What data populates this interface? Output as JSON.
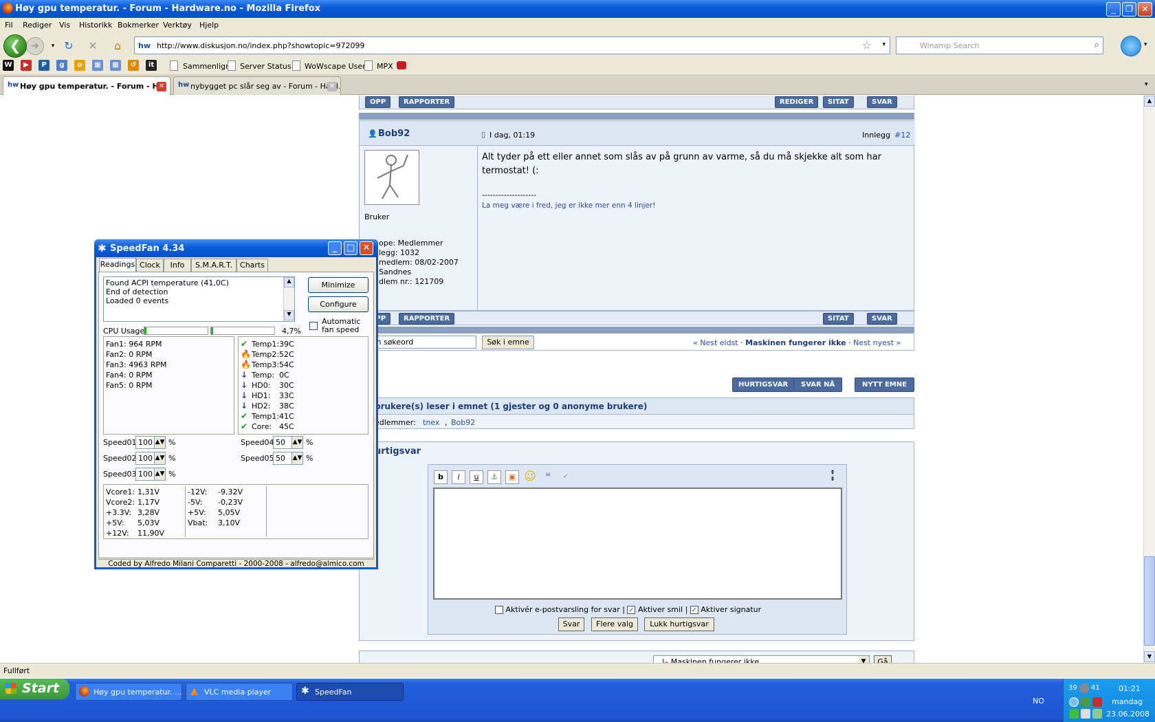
{
  "window": {
    "title": "Høy gpu temperatur. - Forum - Hardware.no - Mozilla Firefox"
  },
  "menu": [
    "Fil",
    "Rediger",
    "Vis",
    "Historikk",
    "Bokmerker",
    "Verktøy",
    "Hjelp"
  ],
  "nav": {
    "url": "http://www.diskusjon.no/index.php?showtopic=972099",
    "search_placeholder": "Winamp Search",
    "url_icon": "hw"
  },
  "bookmarks": [
    "Sammenlign",
    "Server Status",
    "WoWscape User",
    "MPX"
  ],
  "tabs": [
    {
      "label": "Høy gpu temperatur. - Forum - H...",
      "active": true
    },
    {
      "label": "nybygget pc slår seg av - Forum - Hard...",
      "active": false
    }
  ],
  "forum": {
    "top_buttons": {
      "opp": "OPP",
      "rapporter": "RAPPORTER",
      "rediger": "REDIGER",
      "sitat": "SITAT",
      "svar": "SVAR"
    },
    "post": {
      "author": "Bob92",
      "time": "I dag, 01:19",
      "post_label": "Innlegg",
      "post_num": "#12",
      "body_line1": "Alt tyder på ett eller annet som slås av på grunn av varme, så du må skjekke alt som har",
      "body_line2": "termostat! (:",
      "separator": "--------------------",
      "signature": "La meg være i fred, jeg er ikke mer enn 4 linjer!",
      "rank": "Bruker",
      "info": [
        "ope: Medlemmer",
        "legg: 1032",
        "medlem: 08/02-2007",
        "Sandnes",
        "dlem nr.: 121709"
      ]
    },
    "bottom_buttons": {
      "opp": "OPP",
      "rapporter": "RAPPORTER",
      "sitat": "SITAT",
      "svar": "SVAR"
    },
    "search": {
      "value": "g inn søkeord",
      "button": "Søk i emne"
    },
    "pager": {
      "prev": "« Nest eldst",
      "sep1": "·",
      "title": "Maskinen fungerer ikke",
      "sep2": "·",
      "next": "Nest nyest »"
    },
    "actions": [
      "HURTIGSVAR",
      "SVAR NÅ",
      "NYTT EMNE"
    ],
    "readers": {
      "title": "brukere(s) leser i emnet (1 gjester og 0 anonyme brukere)",
      "members_label": "edlemmer:",
      "members": [
        "tnex",
        "Bob92"
      ]
    },
    "quickreply": {
      "title": "urtigsvar",
      "opt1": "Aktivér e-postvarsling for svar",
      "opt2": "Aktiver smil",
      "opt3": "Aktiver signatur",
      "btn_svar": "Svar",
      "btn_flere": "Flere valg",
      "btn_lukk": "Lukk hurtigsvar"
    },
    "jump": {
      "value": "|– Maskinen fungerer ikke",
      "button": "Gå"
    }
  },
  "speedfan": {
    "title": "SpeedFan 4.34",
    "tabs": [
      "Readings",
      "Clock",
      "Info",
      "S.M.A.R.T.",
      "Charts"
    ],
    "log": [
      "Found ACPI temperature (41,0C)",
      "End of detection",
      "Loaded 0 events"
    ],
    "buttons": {
      "minimize": "Minimize",
      "configure": "Configure"
    },
    "auto_fan": "Automatic fan speed",
    "cpu_label": "CPU Usage",
    "cpu_value": "4,7%",
    "cpu_usage_fraction": [
      0.03,
      0.03
    ],
    "fans": [
      "Fan1: 964 RPM",
      "Fan2: 0 RPM",
      "Fan3: 4963 RPM",
      "Fan4: 0 RPM",
      "Fan5: 0 RPM"
    ],
    "temps": [
      {
        "label": "Temp1:",
        "value": "39C",
        "icon": "ok"
      },
      {
        "label": "Temp2:",
        "value": "52C",
        "icon": "fire"
      },
      {
        "label": "Temp3:",
        "value": "54C",
        "icon": "fire"
      },
      {
        "label": "Temp:",
        "value": "0C",
        "icon": "down"
      },
      {
        "label": "HD0:",
        "value": "30C",
        "icon": "down"
      },
      {
        "label": "HD1:",
        "value": "33C",
        "icon": "down"
      },
      {
        "label": "HD2:",
        "value": "38C",
        "icon": "down"
      },
      {
        "label": "Temp1:",
        "value": "41C",
        "icon": "ok"
      },
      {
        "label": "Core:",
        "value": "45C",
        "icon": "ok"
      }
    ],
    "speeds": [
      {
        "label": "Speed01:",
        "value": "100"
      },
      {
        "label": "Speed02:",
        "value": "100"
      },
      {
        "label": "Speed03:",
        "value": "100"
      },
      {
        "label": "Speed04:",
        "value": "50"
      },
      {
        "label": "Speed05:",
        "value": "50"
      }
    ],
    "pct": "%",
    "volts_left": [
      [
        "Vcore1:",
        "1,31V"
      ],
      [
        "Vcore2:",
        "1,17V"
      ],
      [
        "+3.3V:",
        "3,28V"
      ],
      [
        "+5V:",
        "5,03V"
      ],
      [
        "+12V:",
        "11,90V"
      ]
    ],
    "volts_right": [
      [
        "-12V:",
        "-9,32V"
      ],
      [
        "-5V:",
        "-0,23V"
      ],
      [
        "+5V:",
        "5,05V"
      ],
      [
        "Vbat:",
        "3,10V"
      ]
    ],
    "footer": "Coded by Alfredo Milani Comparetti - 2000-2008 - alfredo@almico.com"
  },
  "status": "Fullført",
  "taskbar": {
    "start": "Start",
    "tasks": [
      "Høy gpu temperatur. ...",
      "VLC media player",
      "SpeedFan"
    ],
    "lang": "NO",
    "clock": "01:21",
    "day": "mandag",
    "date": "23.06.2008",
    "tray_nums": [
      "39",
      "41"
    ]
  }
}
